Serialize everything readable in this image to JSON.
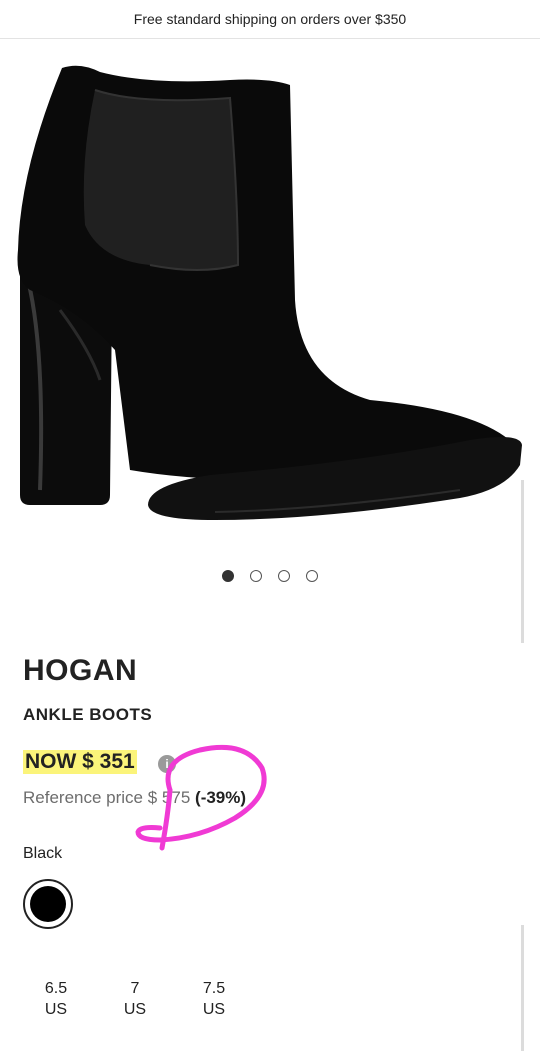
{
  "banner": {
    "text": "Free standard shipping on orders over $350"
  },
  "product": {
    "brand": "HOGAN",
    "category": "ANKLE BOOTS",
    "price_now": "NOW $ 351",
    "reference_label": "Reference price",
    "reference_price": "$ 575",
    "discount": "(-39%)",
    "info_icon": "info-icon"
  },
  "carousel": {
    "total": 4,
    "active": 1
  },
  "color": {
    "label": "Black",
    "swatch": "#000000"
  },
  "sizes": [
    {
      "value": "6.5",
      "unit": "US"
    },
    {
      "value": "7",
      "unit": "US"
    },
    {
      "value": "7.5",
      "unit": "US"
    }
  ],
  "annotation_color": "#f03ad4"
}
